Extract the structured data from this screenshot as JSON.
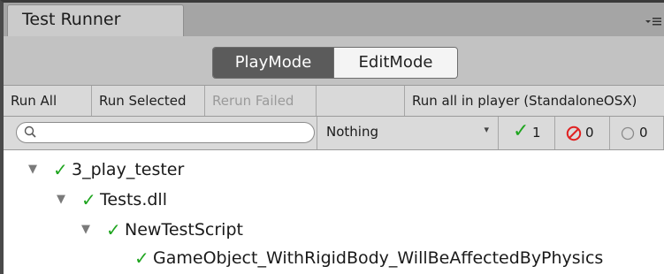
{
  "window": {
    "tab_title": "Test Runner",
    "menu_icon": "menu-icon"
  },
  "mode": {
    "options": [
      "PlayMode",
      "EditMode"
    ],
    "selected": "PlayMode"
  },
  "toolbar": {
    "run_all": "Run All",
    "run_selected": "Run Selected",
    "rerun_failed": "Rerun Failed",
    "run_in_player": "Run all in player (StandaloneOSX)"
  },
  "filter": {
    "search_placeholder": "",
    "category_selected": "Nothing",
    "passed_count": "1",
    "failed_count": "0",
    "skipped_count": "0"
  },
  "tree": {
    "items": [
      {
        "label": "3_play_tester",
        "status": "passed",
        "expanded": true
      },
      {
        "label": "Tests.dll",
        "status": "passed",
        "expanded": true
      },
      {
        "label": "NewTestScript",
        "status": "passed",
        "expanded": true
      },
      {
        "label": "GameObject_WithRigidBody_WillBeAffectedByPhysics",
        "status": "passed"
      }
    ]
  },
  "colors": {
    "pass": "#1fa51f",
    "fail": "#e02020",
    "accent_dark": "#5b5b5b"
  }
}
